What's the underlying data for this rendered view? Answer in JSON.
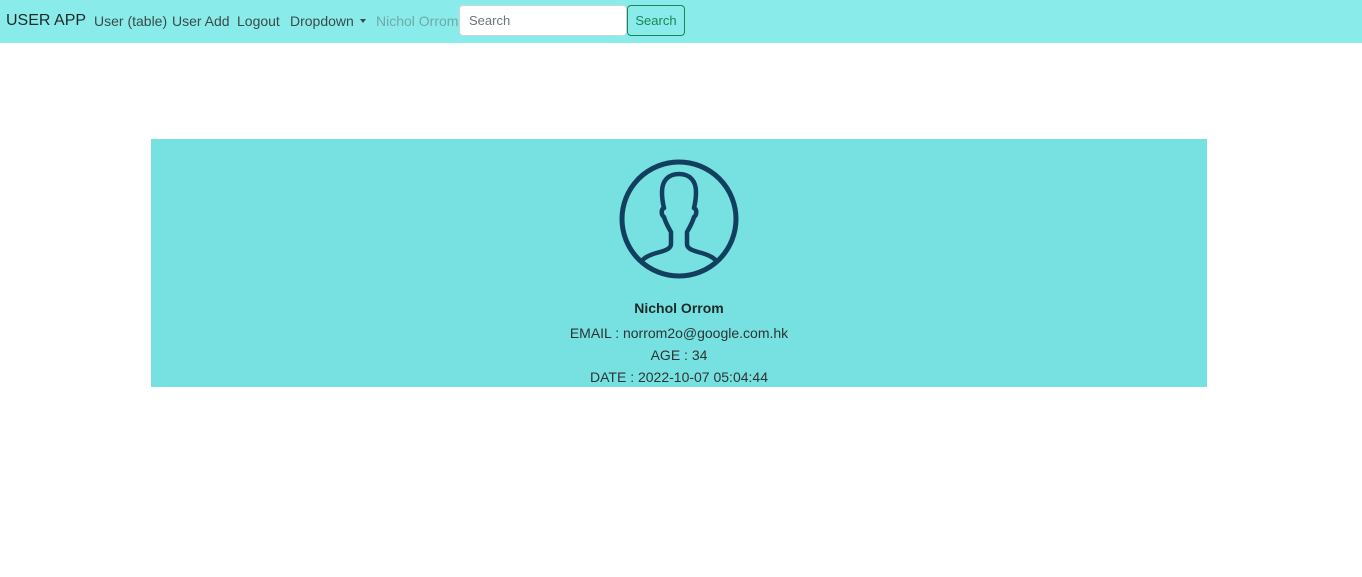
{
  "navbar": {
    "brand": "USER APP",
    "links": [
      "User (table)",
      "User Add",
      "Logout"
    ],
    "dropdown_label": "Dropdown",
    "current_user": "Nichol Orrom",
    "search_placeholder": "Search",
    "search_value": "",
    "search_button": "Search",
    "background_color": "#8aecea"
  },
  "profile": {
    "avatar_icon": "user-silhouette-icon",
    "name": "Nichol Orrom",
    "email_line": "EMAIL : norrom2o@google.com.hk",
    "age_line": "AGE : 34",
    "date_line": "DATE : 2022-10-07 05:04:44",
    "card_color": "#77e0e0",
    "icon_color": "#123f5e"
  }
}
